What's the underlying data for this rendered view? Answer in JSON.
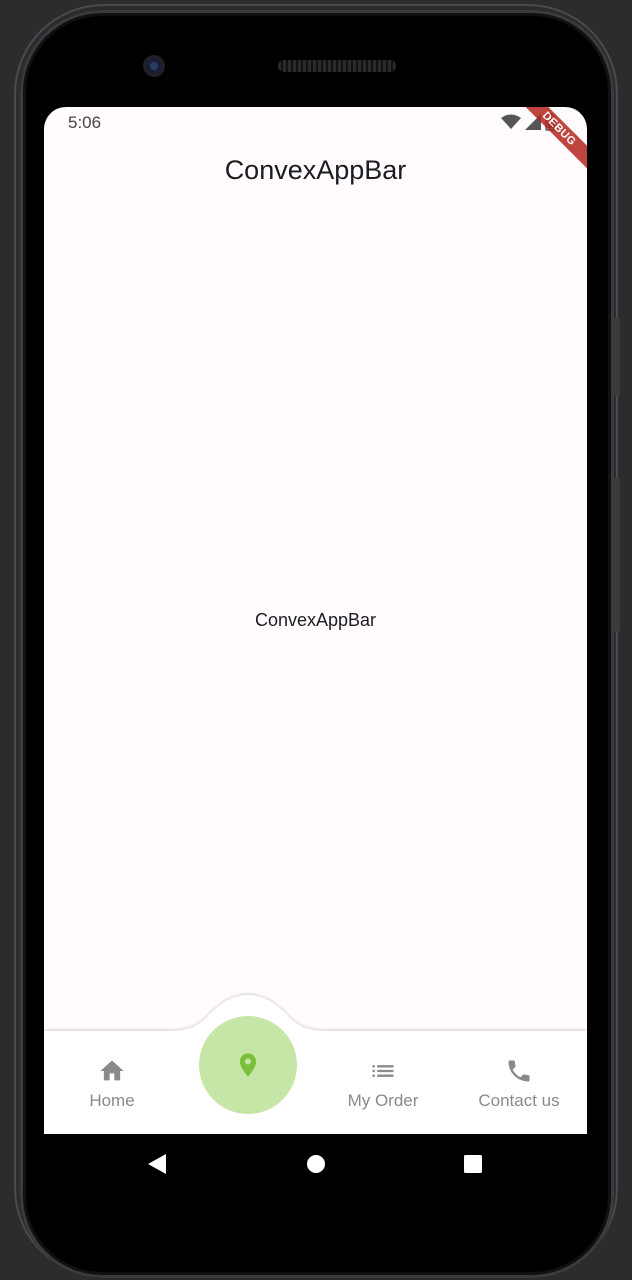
{
  "status_bar": {
    "time": "5:06",
    "debug_label": "DEBUG"
  },
  "app_bar": {
    "title": "ConvexAppBar"
  },
  "body": {
    "text": "ConvexAppBar"
  },
  "bottom_nav": {
    "items": [
      {
        "label": "Home",
        "icon": "home-icon"
      },
      {
        "label": "",
        "icon": "location-pin-icon",
        "active": true
      },
      {
        "label": "My Order",
        "icon": "list-icon"
      },
      {
        "label": "Contact us",
        "icon": "phone-icon"
      }
    ],
    "active_color": "#c5e6a6",
    "active_icon_color": "#7cbf3a",
    "inactive_color": "#8a8a8a"
  },
  "system_nav": {
    "back": "back-icon",
    "home": "home-circle-icon",
    "recents": "recents-icon"
  }
}
